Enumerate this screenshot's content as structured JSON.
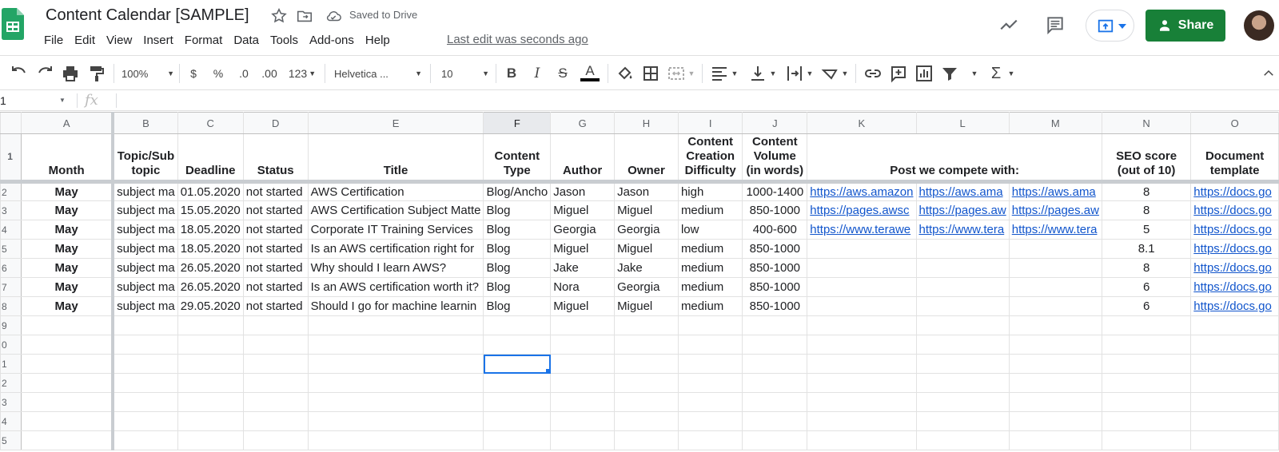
{
  "app": {
    "doc_title": "Content Calendar [SAMPLE]",
    "saved_status": "Saved to Drive",
    "last_edit": "Last edit was seconds ago",
    "share_label": "Share",
    "brand_color": "#188038",
    "accent_color": "#1a73e8"
  },
  "menu": [
    "File",
    "Edit",
    "View",
    "Insert",
    "Format",
    "Data",
    "Tools",
    "Add-ons",
    "Help"
  ],
  "toolbar": {
    "zoom": "100%",
    "currency": "$",
    "percent": "%",
    "dec_decrease": ".0",
    "dec_increase": ".00",
    "more_formats": "123",
    "font": "Helvetica ...",
    "font_size": "10",
    "bold": "B",
    "italic": "I",
    "strike": "S",
    "text_color": "A",
    "sum": "Σ"
  },
  "formula_bar": {
    "cell_ref": "1",
    "fx": "fx",
    "value": ""
  },
  "columns": [
    "A",
    "B",
    "C",
    "D",
    "E",
    "F",
    "G",
    "H",
    "I",
    "J",
    "K",
    "L",
    "M",
    "N",
    "O"
  ],
  "selected_column": "F",
  "header_row": {
    "row_num": "1",
    "cells": [
      "Month",
      "Topic/Sub topic",
      "Deadline",
      "Status",
      "Title",
      "Content Type",
      "Author",
      "Owner",
      "Content Creation Difficulty",
      "Content Volume (in words)",
      "Post we compete with:",
      "",
      "",
      "SEO score (out of 10)",
      "Document template"
    ]
  },
  "rows": [
    {
      "n": "2",
      "month": "May",
      "topic": "subject ma",
      "deadline": "01.05.2020",
      "status": "not started",
      "title": "AWS Certification",
      "type": "Blog/Ancho",
      "author": "Jason",
      "owner": "Jason",
      "difficulty": "high",
      "volume": "1000-1400",
      "k": "https://aws.amazon",
      "l": "https://aws.ama",
      "m": "https://aws.ama",
      "seo": "8",
      "doc": "https://docs.go"
    },
    {
      "n": "3",
      "month": "May",
      "topic": "subject ma",
      "deadline": "15.05.2020",
      "status": "not started",
      "title": "AWS Certification Subject Matte",
      "type": "Blog",
      "author": "Miguel",
      "owner": "Miguel",
      "difficulty": "medium",
      "volume": "850-1000",
      "k": "https://pages.awsc",
      "l": "https://pages.aw",
      "m": "https://pages.aw",
      "seo": "8",
      "doc": "https://docs.go"
    },
    {
      "n": "4",
      "month": "May",
      "topic": "subject ma",
      "deadline": "18.05.2020",
      "status": "not started",
      "title": "Corporate IT Training Services",
      "type": "Blog",
      "author": "Georgia",
      "owner": "Georgia",
      "difficulty": "low",
      "volume": "400-600",
      "k": "https://www.terawe",
      "l": "https://www.tera",
      "m": "https://www.tera",
      "seo": "5",
      "doc": "https://docs.go"
    },
    {
      "n": "5",
      "month": "May",
      "topic": "subject ma",
      "deadline": "18.05.2020",
      "status": "not started",
      "title": "Is an AWS certification right for",
      "type": "Blog",
      "author": "Miguel",
      "owner": "Miguel",
      "difficulty": "medium",
      "volume": "850-1000",
      "k": "",
      "l": "",
      "m": "",
      "seo": "8.1",
      "doc": "https://docs.go"
    },
    {
      "n": "6",
      "month": "May",
      "topic": "subject ma",
      "deadline": "26.05.2020",
      "status": "not started",
      "title": "Why should I learn AWS?",
      "type": "Blog",
      "author": "Jake",
      "owner": "Jake",
      "difficulty": "medium",
      "volume": "850-1000",
      "k": "",
      "l": "",
      "m": "",
      "seo": "8",
      "doc": "https://docs.go"
    },
    {
      "n": "7",
      "month": "May",
      "topic": "subject ma",
      "deadline": "26.05.2020",
      "status": "not started",
      "title": "Is an AWS certification worth it?",
      "type": "Blog",
      "author": "Nora",
      "owner": "Georgia",
      "difficulty": "medium",
      "volume": "850-1000",
      "k": "",
      "l": "",
      "m": "",
      "seo": "6",
      "doc": "https://docs.go"
    },
    {
      "n": "8",
      "month": "May",
      "topic": "subject ma",
      "deadline": "29.05.2020",
      "status": "not started",
      "title": "Should I go for machine learnin",
      "type": "Blog",
      "author": "Miguel",
      "owner": "Miguel",
      "difficulty": "medium",
      "volume": "850-1000",
      "k": "",
      "l": "",
      "m": "",
      "seo": "6",
      "doc": "https://docs.go"
    }
  ],
  "empty_rows": [
    "9",
    "0",
    "1",
    "2",
    "3",
    "4",
    "5"
  ]
}
